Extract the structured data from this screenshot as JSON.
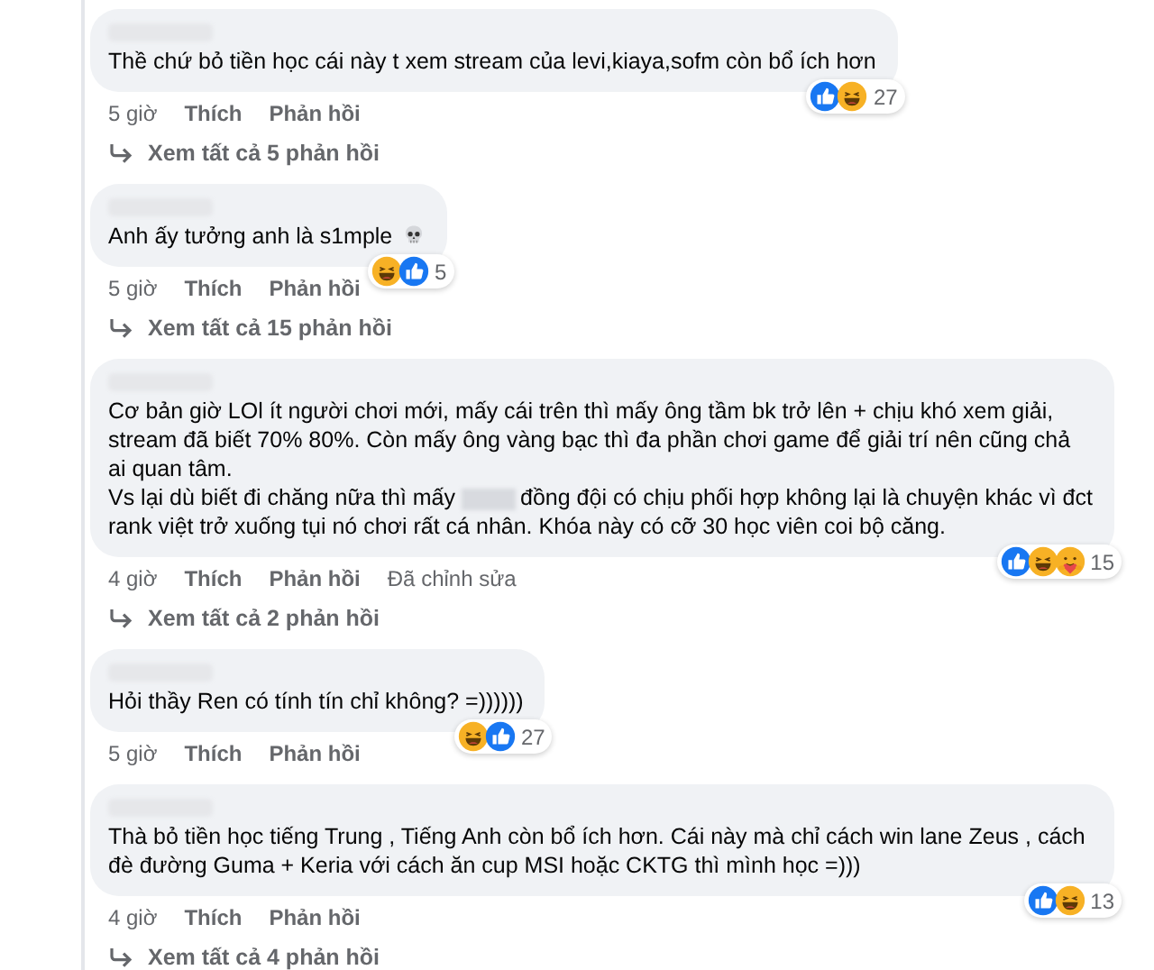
{
  "comments": [
    {
      "paragraphs": [
        [
          {
            "kind": "text",
            "text": "Thề chứ bỏ tiền học cái này t xem stream của levi,kiaya,sofm còn bổ ích hơn"
          }
        ]
      ],
      "reactions": [
        {
          "kind": "like"
        },
        {
          "kind": "haha"
        }
      ],
      "reaction_count": "27",
      "time": "5 giờ",
      "like": "Thích",
      "reply": "Phản hồi",
      "replies_link": "Xem tất cả 5 phản hồi"
    },
    {
      "paragraphs": [
        [
          {
            "kind": "text",
            "text": "Anh ấy tưởng anh là s1mple"
          },
          {
            "kind": "skull"
          }
        ]
      ],
      "reactions": [
        {
          "kind": "haha"
        },
        {
          "kind": "like"
        }
      ],
      "reaction_count": "5",
      "time": "5 giờ",
      "like": "Thích",
      "reply": "Phản hồi",
      "replies_link": "Xem tất cả 15 phản hồi"
    },
    {
      "paragraphs": [
        [
          {
            "kind": "text",
            "text": "Cơ bản giờ LOl ít người chơi mới, mấy cái trên thì mấy ông tầm bk trở lên + chịu khó xem giải, stream đã biết 70% 80%. Còn mấy ông vàng bạc thì đa phần chơi game để giải trí nên cũng chả ai quan tâm."
          }
        ],
        [
          {
            "kind": "text",
            "text": "Vs lại dù biết đi chăng nữa thì mấy"
          },
          {
            "kind": "blur"
          },
          {
            "kind": "text",
            "text": "đồng đội có chịu phối hợp không lại là chuyện khác vì đct"
          }
        ],
        [
          {
            "kind": "text",
            "text": "rank việt trở xuống tụi nó chơi rất cá nhân. Khóa này có cỡ 30 học viên coi bộ căng."
          }
        ]
      ],
      "reactions": [
        {
          "kind": "like"
        },
        {
          "kind": "haha"
        },
        {
          "kind": "care"
        }
      ],
      "reaction_count": "15",
      "time": "4 giờ",
      "like": "Thích",
      "reply": "Phản hồi",
      "edited": "Đã chỉnh sửa",
      "replies_link": "Xem tất cả 2 phản hồi"
    },
    {
      "paragraphs": [
        [
          {
            "kind": "text",
            "text": "Hỏi thầy Ren có tính tín chỉ không? =))))))"
          }
        ]
      ],
      "reactions": [
        {
          "kind": "haha"
        },
        {
          "kind": "like"
        }
      ],
      "reaction_count": "27",
      "time": "5 giờ",
      "like": "Thích",
      "reply": "Phản hồi"
    },
    {
      "paragraphs": [
        [
          {
            "kind": "text",
            "text": "Thà bỏ tiền học tiếng Trung , Tiếng Anh còn bổ ích hơn. Cái này mà chỉ cách win lane Zeus , cách đè đường Guma + Keria với cách ăn cup MSI hoặc CKTG thì mình học =)))"
          }
        ]
      ],
      "reactions": [
        {
          "kind": "like"
        },
        {
          "kind": "haha"
        }
      ],
      "reaction_count": "13",
      "time": "4 giờ",
      "like": "Thích",
      "reply": "Phản hồi",
      "replies_link": "Xem tất cả 4 phản hồi"
    }
  ]
}
